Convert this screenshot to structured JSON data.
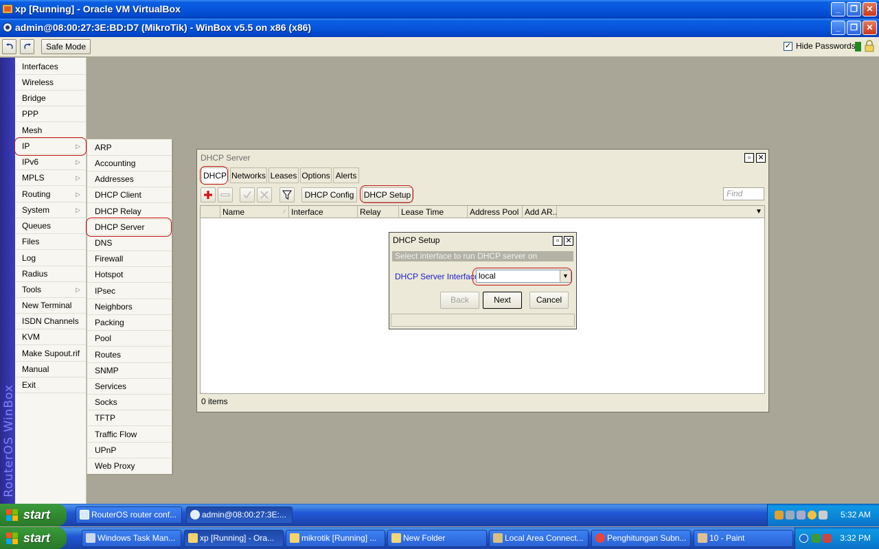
{
  "outer_window": {
    "title": "xp [Running] - Oracle VM VirtualBox"
  },
  "winbox_window": {
    "title": "admin@08:00:27:3E:BD:D7 (MikroTik) - WinBox v5.5 on x86 (x86)"
  },
  "toolbar": {
    "safe_mode": "Safe Mode",
    "hide_passwords_label": "Hide Passwords",
    "hide_passwords_checked": true
  },
  "sidebar_brand": "RouterOS WinBox",
  "main_menu": [
    "Interfaces",
    "Wireless",
    "Bridge",
    "PPP",
    "Mesh",
    "IP",
    "IPv6",
    "MPLS",
    "Routing",
    "System",
    "Queues",
    "Files",
    "Log",
    "Radius",
    "Tools",
    "New Terminal",
    "ISDN Channels",
    "KVM",
    "Make Supout.rif",
    "Manual",
    "Exit"
  ],
  "ip_submenu": [
    "ARP",
    "Accounting",
    "Addresses",
    "DHCP Client",
    "DHCP Relay",
    "DHCP Server",
    "DNS",
    "Firewall",
    "Hotspot",
    "IPsec",
    "Neighbors",
    "Packing",
    "Pool",
    "Routes",
    "SNMP",
    "Services",
    "Socks",
    "TFTP",
    "Traffic Flow",
    "UPnP",
    "Web Proxy"
  ],
  "dhcp_window": {
    "title": "DHCP Server",
    "tabs": [
      "DHCP",
      "Networks",
      "Leases",
      "Options",
      "Alerts"
    ],
    "active_tab": "DHCP",
    "buttons": {
      "config": "DHCP Config",
      "setup": "DHCP Setup"
    },
    "find_placeholder": "Find",
    "columns": [
      "Name",
      "Interface",
      "Relay",
      "Lease Time",
      "Address Pool",
      "Add AR..."
    ],
    "status": "0 items"
  },
  "setup_dialog": {
    "title": "DHCP Setup",
    "description": "Select interface to run DHCP server on",
    "field_label": "DHCP Server Interface:",
    "field_value": "local",
    "back": "Back",
    "next": "Next",
    "cancel": "Cancel"
  },
  "inner_taskbar": {
    "start": "start",
    "tasks": [
      "RouterOS router conf...",
      "admin@08:00:27:3E:..."
    ],
    "clock": "5:32 AM"
  },
  "outer_taskbar": {
    "start": "start",
    "tasks": [
      "Windows Task Man...",
      "xp [Running] - Ora...",
      "mikrotik [Running] ...",
      "New Folder",
      "Local Area Connect...",
      "Penghitungan Subn...",
      "10 - Paint"
    ],
    "clock": "3:32 PM"
  }
}
